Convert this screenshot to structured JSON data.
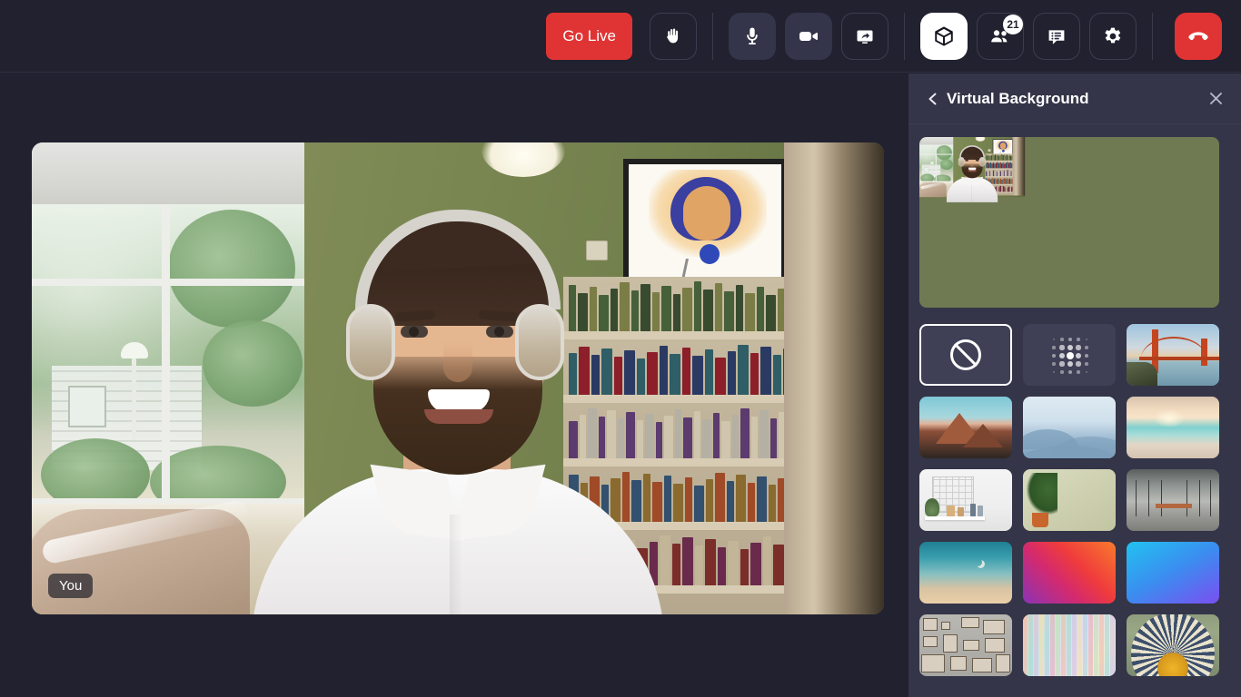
{
  "app": {
    "bg_color": "#21212f",
    "panel_color": "#343548",
    "accent_red": "#e03434",
    "accent_white": "#ffffff"
  },
  "toolbar": {
    "go_live_label": "Go Live",
    "buttons": [
      {
        "name": "raise-hand",
        "icon": "hand-icon",
        "state": "outline"
      },
      {
        "name": "microphone",
        "icon": "microphone-icon",
        "state": "filled"
      },
      {
        "name": "camera",
        "icon": "video-camera-icon",
        "state": "filled"
      },
      {
        "name": "share-screen",
        "icon": "screen-share-icon",
        "state": "outline"
      },
      {
        "name": "effects",
        "icon": "cube-icon",
        "state": "active"
      },
      {
        "name": "participants",
        "icon": "people-icon",
        "state": "outline",
        "badge": "21"
      },
      {
        "name": "chat",
        "icon": "chat-icon",
        "state": "outline"
      },
      {
        "name": "settings",
        "icon": "gear-icon",
        "state": "outline"
      },
      {
        "name": "leave-call",
        "icon": "hangup-phone-icon",
        "state": "danger"
      }
    ],
    "participant_count": "21"
  },
  "stage": {
    "self_label": "You"
  },
  "panel": {
    "title": "Virtual Background",
    "back_icon": "chevron-left-icon",
    "close_icon": "close-icon",
    "preview_label": "self-video-preview",
    "options": [
      {
        "id": "none",
        "label": "None",
        "kind": "icon",
        "icon": "no-background-icon",
        "selected": true
      },
      {
        "id": "blur",
        "label": "Blur",
        "kind": "icon",
        "icon": "blur-icon",
        "selected": false
      },
      {
        "id": "bridge",
        "label": "Golden Gate Bridge",
        "kind": "image",
        "art": "th-bridge",
        "selected": false
      },
      {
        "id": "mountain",
        "label": "Red Mountain",
        "kind": "image",
        "art": "th-mountain",
        "selected": false
      },
      {
        "id": "fog",
        "label": "Misty Mountains",
        "kind": "image",
        "art": "th-fog",
        "selected": false
      },
      {
        "id": "beach",
        "label": "Beach Sunset",
        "kind": "image",
        "art": "th-beach",
        "selected": false
      },
      {
        "id": "whiteroom",
        "label": "White Room Shelf",
        "kind": "image",
        "art": "th-room",
        "selected": false
      },
      {
        "id": "oliveplant",
        "label": "Olive Wall Plant",
        "kind": "image",
        "art": "th-olive",
        "selected": false
      },
      {
        "id": "office",
        "label": "Modern Office",
        "kind": "image",
        "art": "th-office",
        "selected": false
      },
      {
        "id": "skyline",
        "label": "Teal Sky",
        "kind": "image",
        "art": "th-sky",
        "selected": false
      },
      {
        "id": "gradred",
        "label": "Red Gradient",
        "kind": "image",
        "art": "th-gradred",
        "selected": false
      },
      {
        "id": "gradblue",
        "label": "Blue Gradient",
        "kind": "image",
        "art": "th-gradblue",
        "selected": false
      },
      {
        "id": "coffeewall",
        "label": "Coffee Wall",
        "kind": "image",
        "art": "th-coffee",
        "selected": false
      },
      {
        "id": "watercolor",
        "label": "Watercolor",
        "kind": "image",
        "art": "th-watercolor",
        "selected": false
      },
      {
        "id": "fan",
        "label": "Decorative Fan",
        "kind": "image",
        "art": "th-fan",
        "selected": false
      }
    ]
  }
}
